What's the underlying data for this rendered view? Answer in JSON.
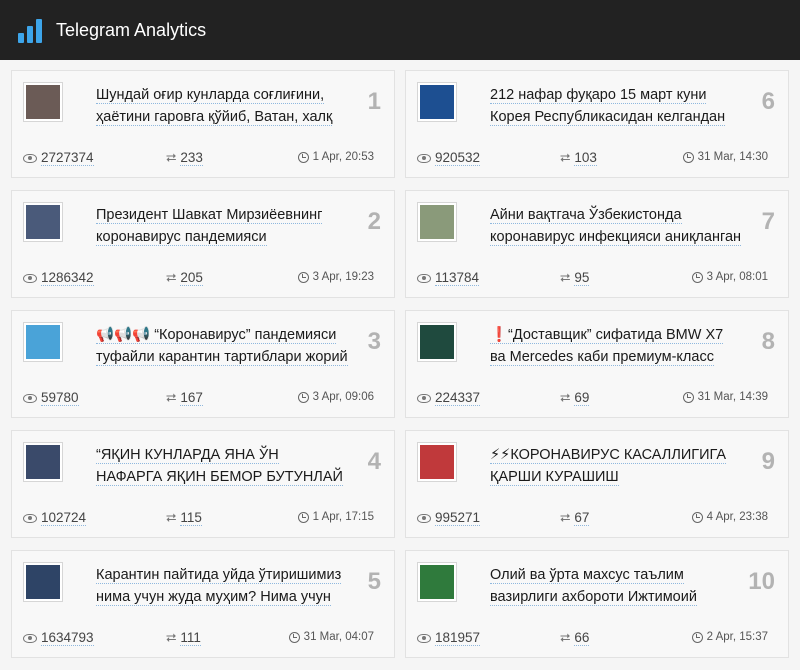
{
  "header": {
    "title": "Telegram Analytics"
  },
  "cards": [
    {
      "rank": "1",
      "title": "Шундай оғир кунларда соғлиғини, ҳаётини гаровга қўйиб, Ватан, халқ",
      "views": "2727374",
      "reposts": "233",
      "date": "1 Apr, 20:53",
      "thumb": "woman-portrait",
      "thumb_color": "#6b5b56"
    },
    {
      "rank": "6",
      "title": "212 нафар фуқаро 15 март куни Корея Республикасидан келгандан",
      "views": "920532",
      "reposts": "103",
      "date": "31 Mar, 14:30",
      "thumb": "k-logo",
      "thumb_color": "#1d4f91"
    },
    {
      "rank": "2",
      "title": "Президент Шавкат Мирзиёевнинг коронавирус пандемияси",
      "views": "1286342",
      "reposts": "205",
      "date": "3 Apr, 19:23",
      "thumb": "president-portrait",
      "thumb_color": "#4a5a7a"
    },
    {
      "rank": "7",
      "title": "Айни вақтгача Ўзбекистонда коронавирус инфекцияси аниқланган",
      "views": "113784",
      "reposts": "95",
      "date": "3 Apr, 08:01",
      "thumb": "building-photo",
      "thumb_color": "#8a9a7a"
    },
    {
      "rank": "3",
      "title": "📢📢📢 “Коронавирус” пандемияси туфайли карантин тартиблари жорий",
      "views": "59780",
      "reposts": "167",
      "date": "3 Apr, 09:06",
      "thumb": "ministry-emblem",
      "thumb_color": "#4aa3d8"
    },
    {
      "rank": "8",
      "title": "❗“Доставщик” сифатида BMW X7 ва Mercedes каби премиум-класс",
      "views": "224337",
      "reposts": "69",
      "date": "31 Mar, 14:39",
      "thumb": "house-logo",
      "thumb_color": "#1f4a3e"
    },
    {
      "rank": "4",
      "title": "“ЯҚИН КУНЛАРДА ЯНА ЎН НАФАРГА ЯҚИН БЕМОР БУТУНЛАЙ",
      "views": "102724",
      "reposts": "115",
      "date": "1 Apr, 17:15",
      "thumb": "official-portrait",
      "thumb_color": "#3a4a6a"
    },
    {
      "rank": "9",
      "title": "⚡⚡КОРОНАВИРУС КАСАЛЛИГИГА ҚАРШИ КУРАШИШ",
      "views": "995271",
      "reposts": "67",
      "date": "4 Apr, 23:38",
      "thumb": "red-emblem",
      "thumb_color": "#c0393b"
    },
    {
      "rank": "5",
      "title": "Карантин пайтида уйда ўтиришимиз нима учун жуда муҳим? Нима учун",
      "views": "1634793",
      "reposts": "111",
      "date": "31 Mar, 04:07",
      "thumb": "man-portrait",
      "thumb_color": "#2e4466"
    },
    {
      "rank": "10",
      "title": "Олий ва ўрта махсус таълим вазирлиги ахбороти Ижтимоий",
      "views": "181957",
      "reposts": "66",
      "date": "2 Apr, 15:37",
      "thumb": "state-emblem",
      "thumb_color": "#2f7a3c"
    }
  ]
}
